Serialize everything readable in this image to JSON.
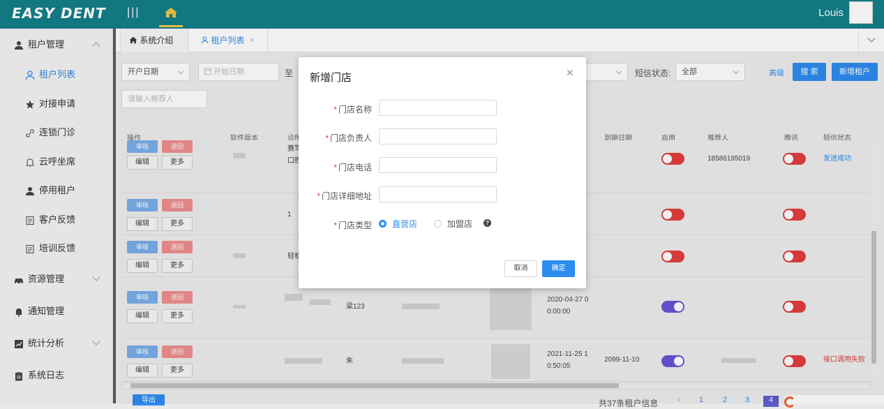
{
  "app": {
    "logo": "EASY DENT",
    "user": "Louis"
  },
  "sidebar": {
    "items": [
      {
        "label": "租户管理",
        "icon": "user-icon"
      },
      {
        "label": "租户列表",
        "icon": "user-outline-icon"
      },
      {
        "label": "对接申请",
        "icon": "star-icon"
      },
      {
        "label": "连锁门诊",
        "icon": "link-icon"
      },
      {
        "label": "云呼坐席",
        "icon": "bell-outline-icon"
      },
      {
        "label": "停用租户",
        "icon": "user-icon"
      },
      {
        "label": "客户反馈",
        "icon": "document-icon"
      },
      {
        "label": "培训反馈",
        "icon": "document-icon"
      },
      {
        "label": "资源管理",
        "icon": "car-icon"
      },
      {
        "label": "通知管理",
        "icon": "bell-icon"
      },
      {
        "label": "统计分析",
        "icon": "chart-icon"
      },
      {
        "label": "系统日志",
        "icon": "clipboard-icon"
      }
    ]
  },
  "tabs": [
    {
      "label": "系统介绍",
      "icon": "home-icon"
    },
    {
      "label": "租户列表",
      "icon": "user-outline-icon",
      "close": "×"
    }
  ],
  "filters": {
    "date_type": "开户日期",
    "start_date_placeholder": "开始日期",
    "to_label": "至",
    "sms_status_label": "短信状态:",
    "sms_status_value": "全部",
    "advanced": "高级",
    "search": "搜 索",
    "add_tenant": "新增租户",
    "referrer_placeholder": "请输入推荐人"
  },
  "table": {
    "headers": [
      "操作",
      "软件版本",
      "诊所",
      "到期日期",
      "启用",
      "推荐人",
      "腾讯",
      "短信状态"
    ],
    "headers_partial_note": "",
    "row_buttons": {
      "audit": "审核",
      "reject": "退回",
      "edit": "编辑",
      "more": "更多"
    },
    "rows": [
      {
        "clinic": "赛骂\n口腔",
        "referrer": "18586195019",
        "sms_status": "发送成功",
        "enabled": false,
        "tencent": false
      },
      {
        "clinic": "1",
        "enabled": false,
        "tencent": false
      },
      {
        "clinic": "轻松",
        "enabled": false,
        "tencent": false
      },
      {
        "name": "梁123",
        "created": "2020-04-27 0\n0:00:00",
        "enabled": true,
        "tencent": false
      },
      {
        "name": "朱",
        "created": "2021-11-25 1\n0:50:05",
        "expire": "2099-11-10",
        "sms_status": "接口调用失败",
        "enabled": true,
        "tencent": false
      }
    ]
  },
  "pagination": {
    "total": "共37条租户信息",
    "pages": [
      "1",
      "2",
      "3",
      "4"
    ],
    "current": "4",
    "export": "导出"
  },
  "modal": {
    "title": "新增门店",
    "fields": [
      {
        "label": "门店名称",
        "required": "*"
      },
      {
        "label": "门店负责人",
        "required": "*"
      },
      {
        "label": "门店电话",
        "required": "*"
      },
      {
        "label": "门店详细地址",
        "required": "*"
      }
    ],
    "type_label": "门店类型",
    "type_options": [
      "直营店",
      "加盟店"
    ],
    "type_selected": "直营店",
    "cancel": "取消",
    "ok": "确定"
  },
  "colors": {
    "topbar": "#137f8a",
    "accent": "#2d8cf0",
    "danger": "#e33d3d",
    "toggle_on": "#6554d6"
  }
}
